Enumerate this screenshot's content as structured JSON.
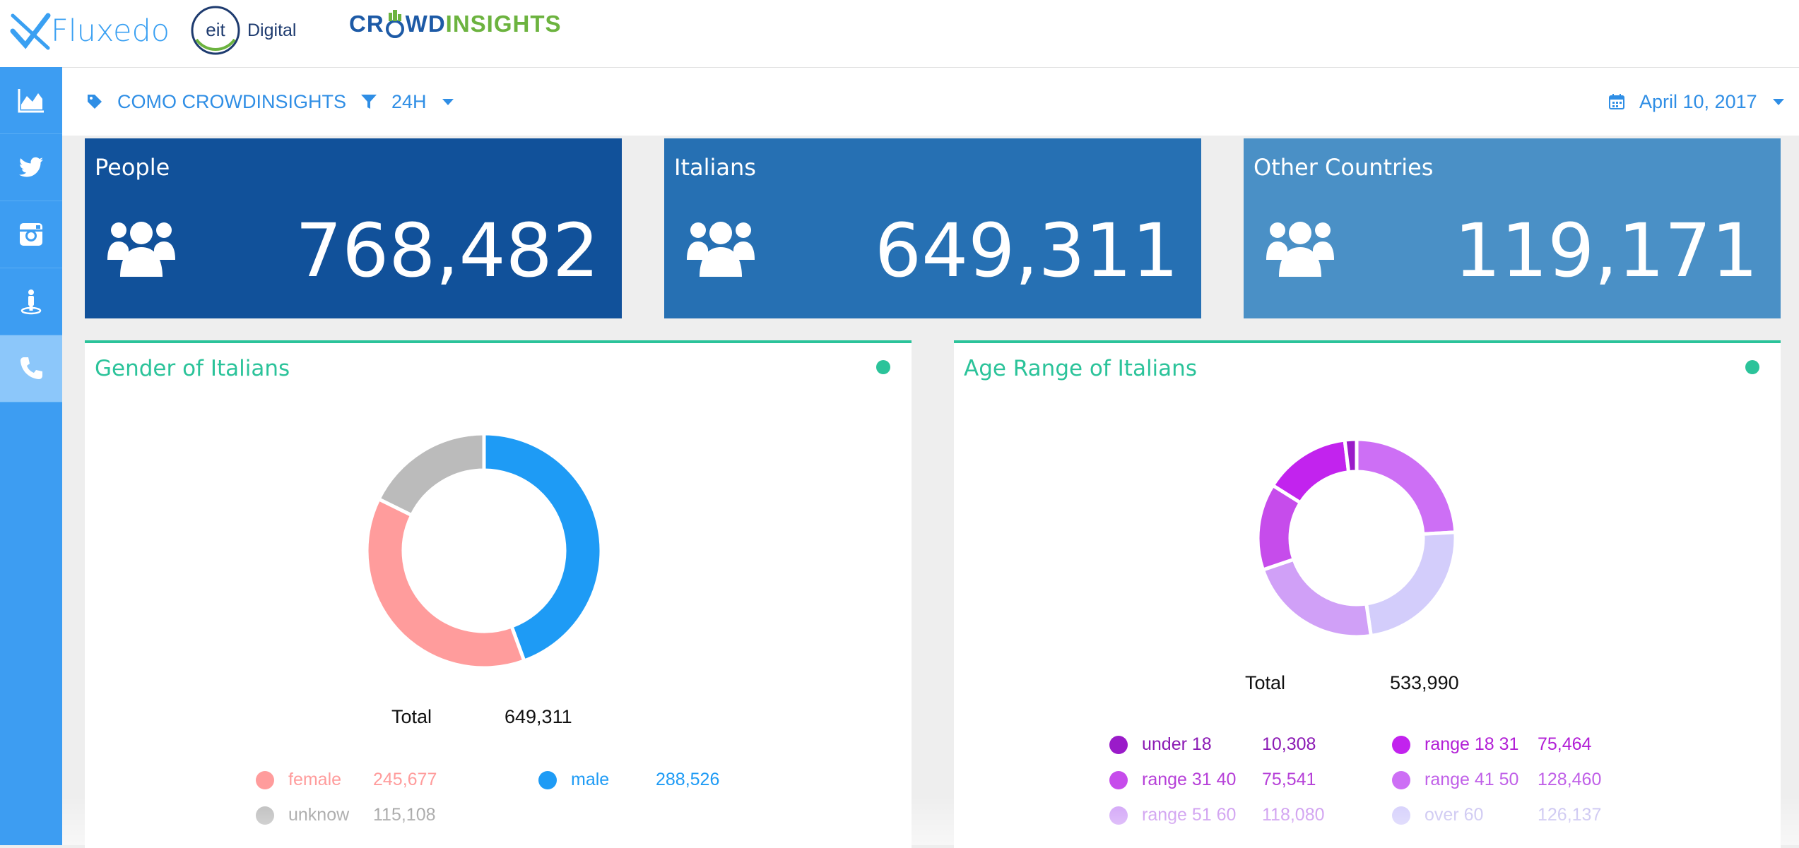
{
  "brands": {
    "fluxedo": "Fluxedo",
    "eit_mark": "eit",
    "eit_word": "Digital",
    "crowd_a": "CR",
    "crowd_b": "WD",
    "crowd_c": "INSIGHTS"
  },
  "sidebar": {
    "items": [
      {
        "icon": "area-chart-icon"
      },
      {
        "icon": "twitter-icon"
      },
      {
        "icon": "instagram-icon"
      },
      {
        "icon": "person-pin-icon"
      },
      {
        "icon": "phone-icon",
        "active": true
      }
    ]
  },
  "toolbar": {
    "tag_label": "COMO CROWDINSIGHTS",
    "filter_label": "24H",
    "date_label": "April 10, 2017"
  },
  "cards": [
    {
      "title": "People",
      "value": "768,482",
      "color": "#11519a"
    },
    {
      "title": "Italians",
      "value": "649,311",
      "color": "#2670b3"
    },
    {
      "title": "Other Countries",
      "value": "119,171",
      "color": "#4a90c6"
    }
  ],
  "gender_panel": {
    "title": "Gender of Italians",
    "total_label": "Total",
    "total_value": "649,311",
    "legend": [
      {
        "label": "female",
        "value": "245,677",
        "color": "#ff9c9c"
      },
      {
        "label": "male",
        "value": "288,526",
        "color": "#1e9bf5"
      },
      {
        "label": "unknow",
        "value": "115,108",
        "color": "#bbbbbb"
      }
    ]
  },
  "age_panel": {
    "title": "Age Range of Italians",
    "total_label": "Total",
    "total_value": "533,990",
    "legend": [
      {
        "label": "under 18",
        "value": "10,308",
        "color": "#9a1bc9"
      },
      {
        "label": "range 18 31",
        "value": "75,464",
        "color": "#c223ee"
      },
      {
        "label": "range 31 40",
        "value": "75,541",
        "color": "#c64ceb"
      },
      {
        "label": "range 41 50",
        "value": "128,460",
        "color": "#cd6ff5"
      },
      {
        "label": "range 51 60",
        "value": "118,080",
        "color": "#d0a0f7"
      },
      {
        "label": "over 60",
        "value": "126,137",
        "color": "#d3cdfb"
      }
    ]
  },
  "chart_data": [
    {
      "type": "pie",
      "title": "Gender of Italians",
      "categories": [
        "male",
        "female",
        "unknow"
      ],
      "values": [
        288526,
        245677,
        115108
      ],
      "colors": [
        "#1e9bf5",
        "#ff9c9c",
        "#bbbbbb"
      ]
    },
    {
      "type": "pie",
      "title": "Age Range of Italians",
      "categories": [
        "range 41 50",
        "over 60",
        "range 51 60",
        "range 31 40",
        "range 18 31",
        "under 18"
      ],
      "values": [
        128460,
        126137,
        118080,
        75541,
        75464,
        10308
      ],
      "colors": [
        "#cd6ff5",
        "#d3cdfb",
        "#d0a0f7",
        "#c64ceb",
        "#c223ee",
        "#9a1bc9"
      ]
    }
  ]
}
